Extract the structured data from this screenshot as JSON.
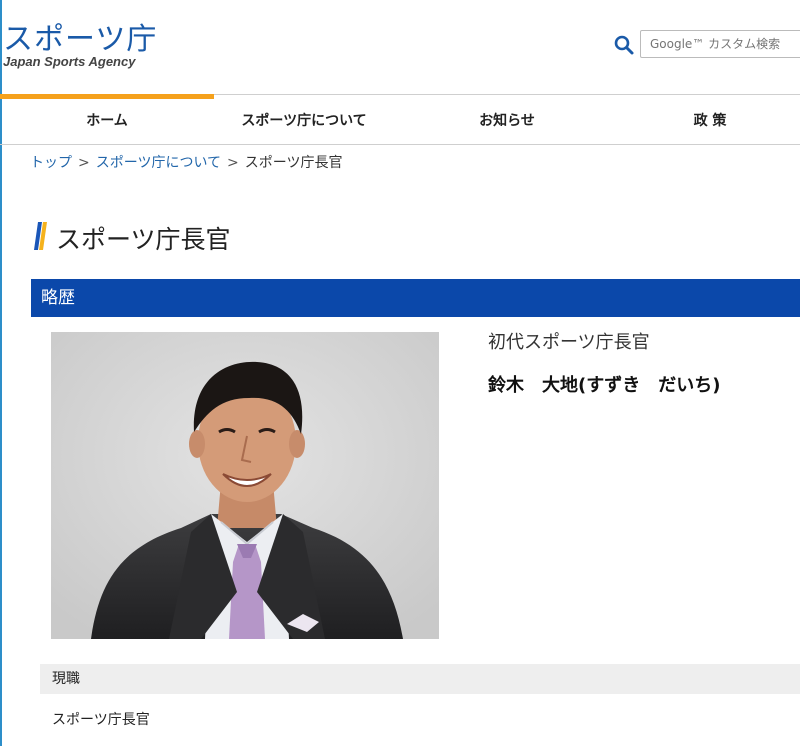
{
  "header": {
    "logo_ja": "スポーツ庁",
    "logo_en": "Japan Sports Agency",
    "search": {
      "icon": "search-icon",
      "placeholder": "Google™ カスタム検索"
    }
  },
  "nav": {
    "items": [
      {
        "label": "ホーム",
        "active": true
      },
      {
        "label": "スポーツ庁について",
        "active": false
      },
      {
        "label": "お知らせ",
        "active": false
      },
      {
        "label": "政 策",
        "active": false
      }
    ]
  },
  "breadcrumb": {
    "items": [
      "トップ",
      "スポーツ庁について",
      "スポーツ庁長官"
    ],
    "separator": ">"
  },
  "page": {
    "title": "スポーツ庁長官",
    "section_heading": "略歴",
    "role": "初代スポーツ庁長官",
    "name": "鈴木　大地(すずき　だいち)",
    "current_position_heading": "現職",
    "current_position_value": "スポーツ庁長官"
  },
  "colors": {
    "brand_blue": "#0b48aa",
    "link_blue": "#2266aa",
    "accent_orange": "#f5a11c",
    "title_mark_blue": "#1a56b8",
    "title_mark_yellow": "#f5b21c"
  }
}
